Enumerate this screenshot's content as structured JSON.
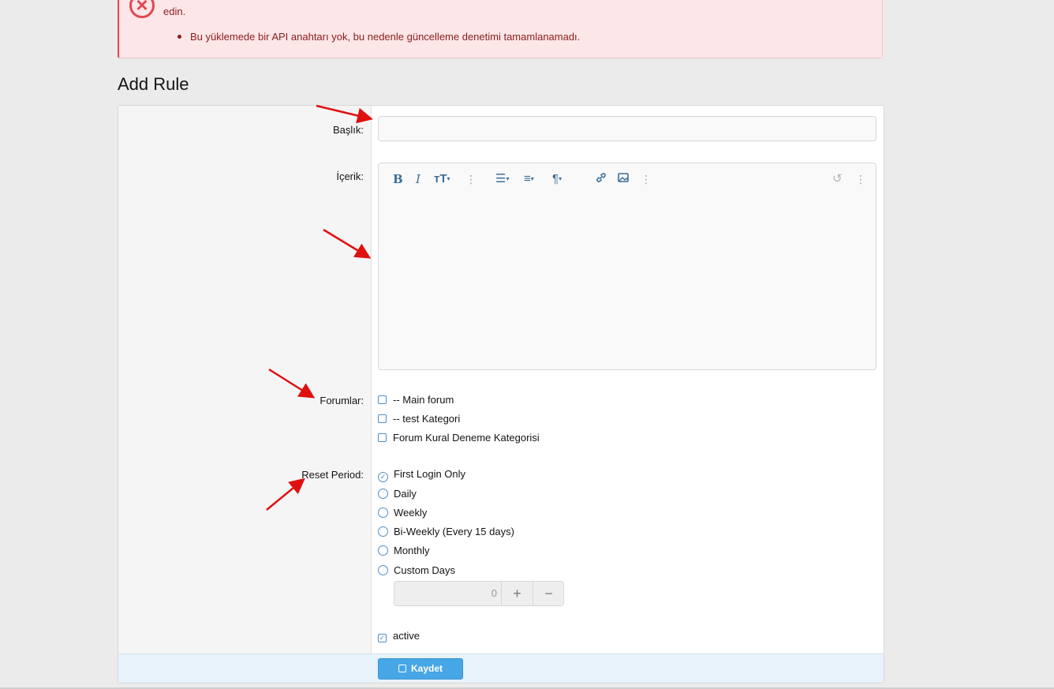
{
  "error": {
    "top_text": "",
    "top_link": "",
    "tail_text": "edin.",
    "items": [
      "Bu yüklemede bir API anahtarı yok, bu nedenle güncelleme denetimi tamamlanamadı."
    ]
  },
  "page": {
    "title": "Add Rule"
  },
  "form": {
    "title_label": "Başlık:",
    "title_value": "",
    "content_label": "İçerik:",
    "forums_label": "Forumlar:",
    "forums": [
      {
        "label": "-- Main forum",
        "checked": false
      },
      {
        "label": "-- test Kategori",
        "checked": false
      },
      {
        "label": "Forum Kural Deneme Kategorisi",
        "checked": false
      }
    ],
    "reset_label": "Reset Period:",
    "reset_options": [
      {
        "label": "First Login Only",
        "selected": true
      },
      {
        "label": "Daily",
        "selected": false
      },
      {
        "label": "Weekly",
        "selected": false
      },
      {
        "label": "Bi-Weekly (Every 15 days)",
        "selected": false
      },
      {
        "label": "Monthly",
        "selected": false
      },
      {
        "label": "Custom Days",
        "selected": false
      }
    ],
    "custom_days_value": "0",
    "stepper_plus": "+",
    "stepper_minus": "−",
    "active_label": "active",
    "active_checked": true,
    "save_label": "Kaydet"
  },
  "editor_toolbar": {
    "bold": "B",
    "italic": "I",
    "text_size": "тT",
    "more": "⋮",
    "list": "☰",
    "align": "≡",
    "paragraph": "¶",
    "link": "🔗",
    "image": "▣",
    "undo": "↺"
  },
  "colors": {
    "error_bg": "#fde6e8",
    "error_text": "#8b1c1c",
    "accent": "#47a6e6",
    "arrow": "#e01010"
  }
}
